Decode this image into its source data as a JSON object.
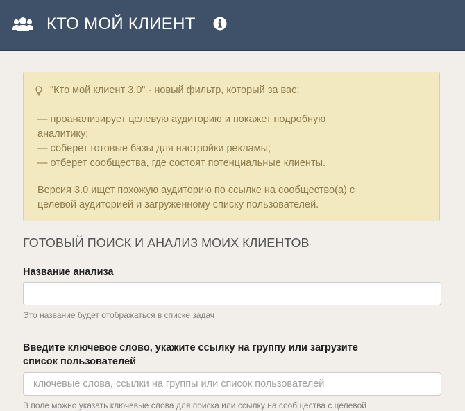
{
  "header": {
    "title": "КТО МОЙ КЛИЕНТ",
    "users_icon": "users-icon",
    "info_icon": "info-circle-icon",
    "background": "#3f5169"
  },
  "info_panel": {
    "icon": "lightbulb-icon",
    "lines": [
      "\"Кто мой клиент 3.0\" - новый фильтр, который за вас:",
      "— проанализирует целевую аудиторию и покажет подробную",
      "аналитику;",
      "— соберет готовые базы для настройки рекламы;",
      "— отберет сообщества, где состоят потенциальные клиенты.",
      "Версия 3.0 ищет похожую аудиторию по ссылке на сообщество(а) с",
      "целевой аудиторией и загруженному списку пользователей."
    ],
    "background": "#f3e9c0",
    "text_color": "#8c7b4d"
  },
  "section": {
    "title": "ГОТОВЫЙ ПОИСК И АНАЛИЗ МОИХ КЛИЕНТОВ"
  },
  "fields": {
    "analysis_name": {
      "label": "Название анализа",
      "value": "",
      "placeholder": "",
      "help": "Это название будет отображаться в списке задач"
    },
    "keywords": {
      "label_line1": "Введите ключевое слово, укажите ссылку на группу или загрузите",
      "label_line2": "список пользователей",
      "value": "",
      "placeholder": "ключевые слова, ссылки на группы или список пользователей",
      "help": "В поле можно указать ключевые слова для поиска или ссылку на сообщества с целевой"
    }
  }
}
